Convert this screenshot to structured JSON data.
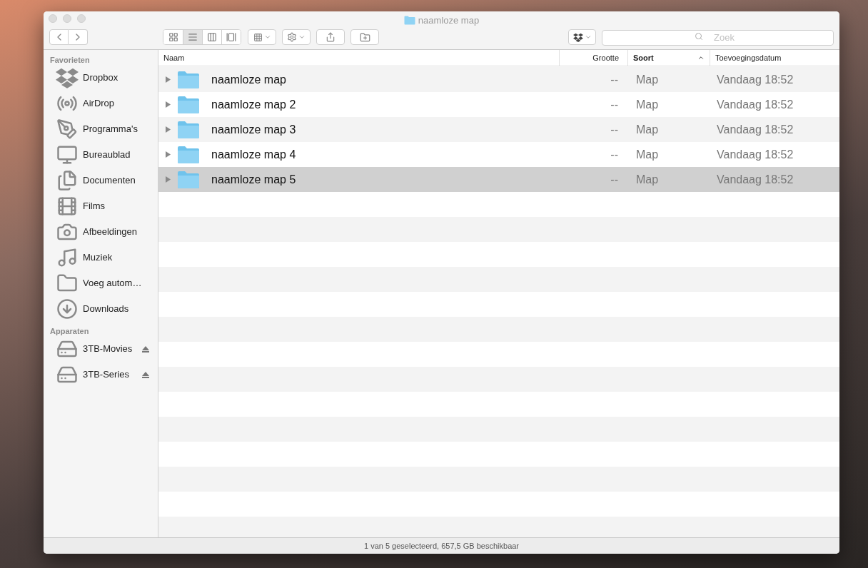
{
  "window": {
    "title": "naamloze map"
  },
  "toolbar": {
    "view_modes": [
      {
        "kind": "icons",
        "selected": false
      },
      {
        "kind": "list",
        "selected": true
      },
      {
        "kind": "columns",
        "selected": false
      },
      {
        "kind": "coverflow",
        "selected": false
      }
    ]
  },
  "search": {
    "placeholder": "Zoek"
  },
  "sidebar": {
    "sections": [
      {
        "title": "Favorieten",
        "items": [
          {
            "label": "Dropbox",
            "kind": "dropbox"
          },
          {
            "label": "AirDrop",
            "kind": "airdrop"
          },
          {
            "label": "Programma's",
            "kind": "apps"
          },
          {
            "label": "Bureaublad",
            "kind": "desktop"
          },
          {
            "label": "Documenten",
            "kind": "documents"
          },
          {
            "label": "Films",
            "kind": "films"
          },
          {
            "label": "Afbeeldingen",
            "kind": "pictures"
          },
          {
            "label": "Muziek",
            "kind": "music"
          },
          {
            "label": "Voeg autom…",
            "kind": "folder"
          },
          {
            "label": "Downloads",
            "kind": "downloads"
          }
        ]
      },
      {
        "title": "Apparaten",
        "items": [
          {
            "label": "3TB-Movies",
            "kind": "disk"
          },
          {
            "label": "3TB-Series",
            "kind": "disk"
          }
        ]
      }
    ]
  },
  "table": {
    "columns": [
      {
        "label": "Naam",
        "sorted": false
      },
      {
        "label": "Grootte",
        "sorted": false
      },
      {
        "label": "Soort",
        "sorted": true
      },
      {
        "label": "Toevoegingsdatum",
        "sorted": false
      }
    ],
    "rows": [
      {
        "name": "naamloze map",
        "size": "--",
        "kind": "Map",
        "date": "Vandaag 18:52",
        "selected": false
      },
      {
        "name": "naamloze map 2",
        "size": "--",
        "kind": "Map",
        "date": "Vandaag 18:52",
        "selected": false
      },
      {
        "name": "naamloze map 3",
        "size": "--",
        "kind": "Map",
        "date": "Vandaag 18:52",
        "selected": false
      },
      {
        "name": "naamloze map 4",
        "size": "--",
        "kind": "Map",
        "date": "Vandaag 18:52",
        "selected": false
      },
      {
        "name": "naamloze map 5",
        "size": "--",
        "kind": "Map",
        "date": "Vandaag 18:52",
        "selected": true
      }
    ]
  },
  "status_bar": "1 van 5 geselecteerd, 657,5 GB beschikbaar"
}
